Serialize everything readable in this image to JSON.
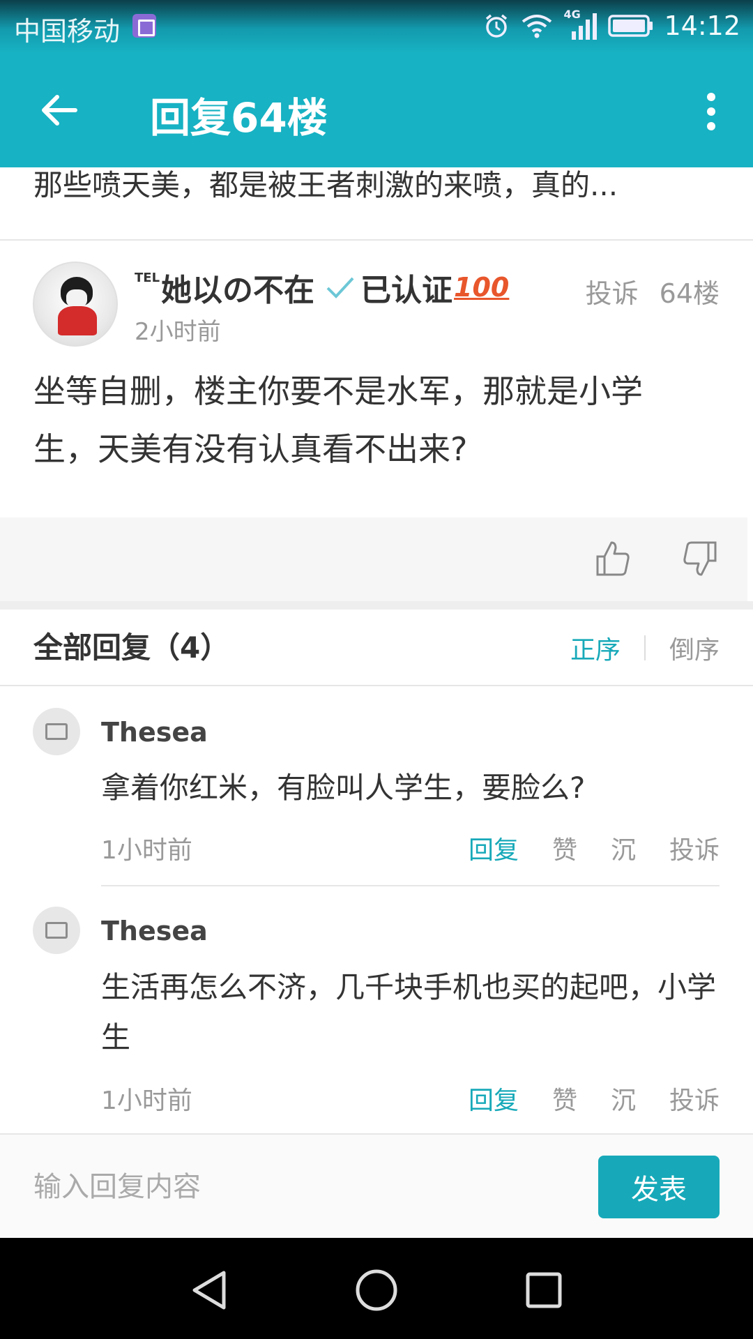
{
  "status_bar": {
    "carrier": "中国移动",
    "network": "4G",
    "time": "14:12",
    "icons": [
      "gallery-notification-icon",
      "alarm-icon",
      "wifi-icon",
      "signal-icon",
      "battery-icon"
    ]
  },
  "app_bar": {
    "title": "回复64楼",
    "back_icon": "arrow-left-icon",
    "more_icon": "more-vertical-icon"
  },
  "previous_reply_preview": "那些喷天美，都是被王者刺激的来喷，真的...",
  "post": {
    "username_prefix": "TEL",
    "username": "她以の不在",
    "verified_label": "已认证",
    "badge": "100",
    "time": "2小时前",
    "report_label": "投诉",
    "floor": "64楼",
    "content": "坐等自删，楼主你要不是水军，那就是小学生，天美有没有认真看不出来?"
  },
  "replies_section": {
    "title": "全部回复（4）",
    "sort_asc": "正序",
    "sort_desc": "倒序"
  },
  "replies": [
    {
      "name": "Thesea",
      "text": "拿着你红米，有脸叫人学生，要脸么?",
      "time": "1小时前",
      "actions": {
        "reply": "回复",
        "like": "赞",
        "sink": "沉",
        "report": "投诉"
      }
    },
    {
      "name": "Thesea",
      "text": "生活再怎么不济，几千块手机也买的起吧，小学生",
      "time": "1小时前",
      "actions": {
        "reply": "回复",
        "like": "赞",
        "sink": "沉",
        "report": "投诉"
      }
    }
  ],
  "input_bar": {
    "placeholder": "输入回复内容",
    "send_label": "发表"
  },
  "colors": {
    "primary": "#17b2c3",
    "accent_text": "#17a9b9",
    "badge": "#e8562c",
    "muted": "#999999"
  }
}
